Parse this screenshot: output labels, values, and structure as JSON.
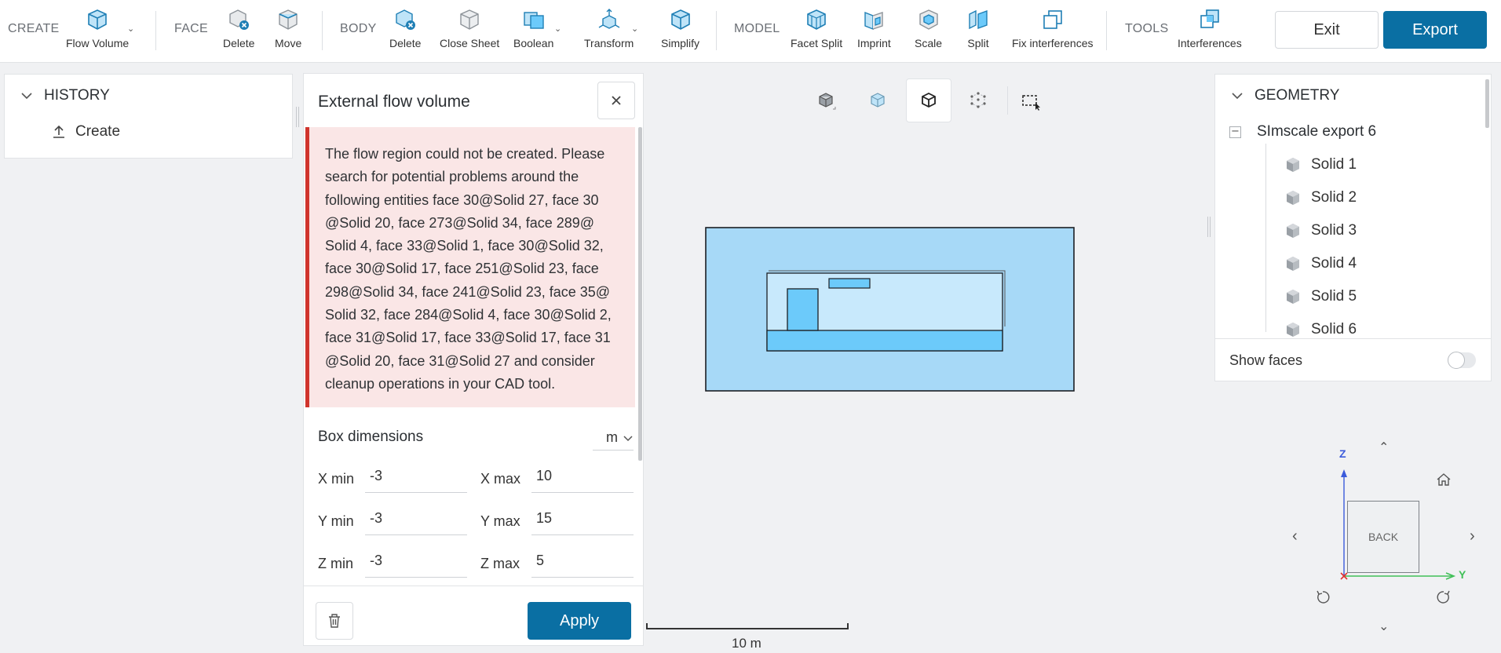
{
  "toolbar": {
    "sections": {
      "create": "CREATE",
      "face": "FACE",
      "body": "BODY",
      "model": "MODEL",
      "tools": "TOOLS"
    },
    "create": {
      "flow_volume": "Flow Volume"
    },
    "face": {
      "delete": "Delete",
      "move": "Move"
    },
    "body": {
      "delete": "Delete",
      "close_sheet": "Close Sheet",
      "boolean": "Boolean",
      "transform": "Transform",
      "simplify": "Simplify"
    },
    "model": {
      "facet_split": "Facet Split",
      "imprint": "Imprint",
      "scale": "Scale",
      "split": "Split",
      "fix_interferences": "Fix interferences"
    },
    "tools": {
      "interferences": "Interferences"
    },
    "exit_label": "Exit",
    "export_label": "Export"
  },
  "history": {
    "title": "HISTORY",
    "items": [
      {
        "label": "Create",
        "icon": "upload-icon"
      }
    ]
  },
  "flow_panel": {
    "title": "External flow volume",
    "error_message": "The flow region could not be created. Please search for potential problems around the following entities face 30@Solid 27, face 30 @Solid 20, face 273@Solid 34, face 289@ Solid 4, face 33@Solid 1, face 30@Solid 32, face 30@Solid 17, face 251@Solid 23, face 298@Solid 34, face 241@Solid 23, face 35@ Solid 32, face 284@Solid 4, face 30@Solid 2, face 31@Solid 17, face 33@Solid 17, face 31 @Solid 20, face 31@Solid 27 and consider cleanup operations in your CAD tool.",
    "box_dimensions_title": "Box dimensions",
    "unit": "m",
    "fields": {
      "x_min_label": "X min",
      "x_min": "-3",
      "x_max_label": "X max",
      "x_max": "10",
      "y_min_label": "Y min",
      "y_min": "-3",
      "y_max_label": "Y max",
      "y_max": "15",
      "z_min_label": "Z min",
      "z_min": "-3",
      "z_max_label": "Z max",
      "z_max": "5"
    },
    "apply_label": "Apply"
  },
  "viewport": {
    "scale_label": "10 m",
    "view_tools": [
      "solid-view-icon",
      "transparent-view-icon",
      "wireframe-view-icon",
      "points-view-icon",
      "box-select-icon"
    ],
    "colors": {
      "flow_box": "#a7d9f7",
      "model_body": "#6ccafa",
      "model_inner": "#c8e9fc"
    }
  },
  "geometry": {
    "title": "GEOMETRY",
    "root": "SImscale export 6",
    "items": [
      "Solid 1",
      "Solid 2",
      "Solid 3",
      "Solid 4",
      "Solid 5",
      "Solid 6"
    ],
    "show_faces_label": "Show faces",
    "show_faces": false
  },
  "view_cube": {
    "face_label": "BACK",
    "axis_z": "Z",
    "axis_y": "Y",
    "colors": {
      "z": "#3b5bdb",
      "y": "#40c057",
      "x": "#e03131"
    }
  },
  "colors": {
    "accent": "#0a6fa3",
    "error_bg": "#fae6e6",
    "error_border": "#d0342c"
  }
}
